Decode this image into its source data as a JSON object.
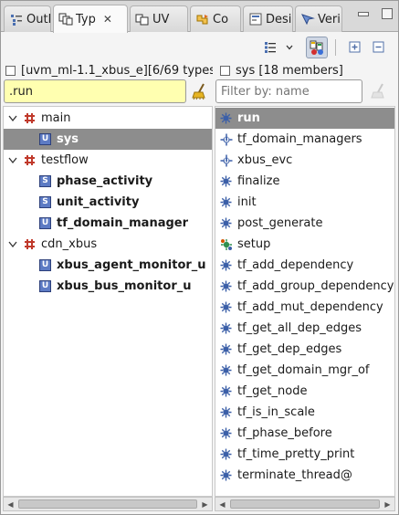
{
  "tabs": [
    {
      "label": "Outl",
      "icon": "outline-icon"
    },
    {
      "label": "Typ",
      "icon": "type-hierarchy-icon",
      "active": true,
      "close": "✕"
    },
    {
      "label": "UV",
      "icon": "uvm-view-icon"
    },
    {
      "label": "Co",
      "icon": "coverage-icon"
    },
    {
      "label": "Desi",
      "icon": "design-icon"
    },
    {
      "label": "Veri",
      "icon": "verification-icon"
    }
  ],
  "left_pane": {
    "header": "[uvm_ml-1.1_xbus_e][6/69 types",
    "filter_value": ".run",
    "tree": [
      {
        "label": "main",
        "level": 0,
        "kind": "folder",
        "expanded": true
      },
      {
        "label": "sys",
        "level": 1,
        "kind": "unit",
        "badge": "U",
        "bold": true,
        "selected": true
      },
      {
        "label": "testflow",
        "level": 0,
        "kind": "folder",
        "expanded": true
      },
      {
        "label": "phase_activity",
        "level": 1,
        "kind": "struct",
        "badge": "S",
        "bold": true
      },
      {
        "label": "unit_activity",
        "level": 1,
        "kind": "struct",
        "badge": "S",
        "bold": true
      },
      {
        "label": "tf_domain_manager",
        "level": 1,
        "kind": "unit",
        "badge": "U",
        "bold": true
      },
      {
        "label": "cdn_xbus",
        "level": 0,
        "kind": "folder",
        "expanded": true
      },
      {
        "label": "xbus_agent_monitor_u",
        "level": 1,
        "kind": "unit",
        "badge": "U",
        "bold": true
      },
      {
        "label": "xbus_bus_monitor_u",
        "level": 1,
        "kind": "unit",
        "badge": "U",
        "bold": true
      }
    ]
  },
  "right_pane": {
    "header": "sys [18 members]",
    "filter_placeholder": "Filter by: name",
    "members": [
      {
        "label": "run",
        "icon": "method-icon",
        "bold": true,
        "selected": true
      },
      {
        "label": "tf_domain_managers",
        "icon": "field-unit-icon"
      },
      {
        "label": "xbus_evc",
        "icon": "field-unit-icon"
      },
      {
        "label": "finalize",
        "icon": "method-icon"
      },
      {
        "label": "init",
        "icon": "method-icon"
      },
      {
        "label": "post_generate",
        "icon": "method-icon"
      },
      {
        "label": "setup",
        "icon": "method-extended-icon"
      },
      {
        "label": "tf_add_dependency",
        "icon": "method-icon"
      },
      {
        "label": "tf_add_group_dependency",
        "icon": "method-icon"
      },
      {
        "label": "tf_add_mut_dependency",
        "icon": "method-icon"
      },
      {
        "label": "tf_get_all_dep_edges",
        "icon": "method-icon"
      },
      {
        "label": "tf_get_dep_edges",
        "icon": "method-icon"
      },
      {
        "label": "tf_get_domain_mgr_of",
        "icon": "method-icon"
      },
      {
        "label": "tf_get_node",
        "icon": "method-icon"
      },
      {
        "label": "tf_is_in_scale",
        "icon": "method-icon"
      },
      {
        "label": "tf_phase_before",
        "icon": "method-icon"
      },
      {
        "label": "tf_time_pretty_print",
        "icon": "method-icon"
      },
      {
        "label": "terminate_thread@",
        "icon": "method-icon"
      }
    ]
  },
  "colors": {
    "filter_match_bg": "#ffffb0",
    "selection_bg": "#8d8d8d",
    "unit_badge": "#5d7bc4",
    "folder_icon": "#c0392b"
  }
}
